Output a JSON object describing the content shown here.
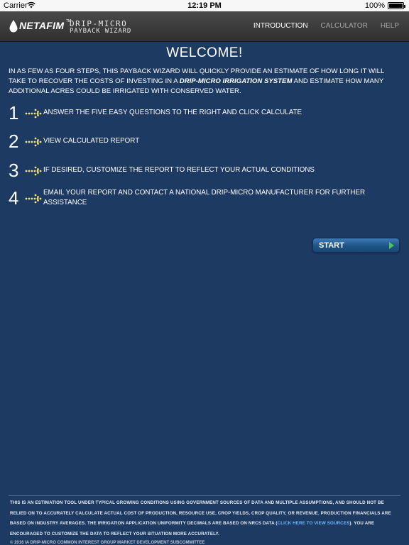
{
  "status_bar": {
    "carrier": "Carrier",
    "time": "12:19 PM",
    "battery": "100%",
    "battery_level": 1.0
  },
  "header": {
    "brand": "NETAFIM",
    "trademark": "TM",
    "product": "DRIP-MICRO",
    "subtitle": "PAYBACK WIZARD",
    "tabs": [
      {
        "label": "INTRODUCTION",
        "active": true
      },
      {
        "label": "CALCULATOR",
        "active": false
      },
      {
        "label": "HELP",
        "active": false
      }
    ]
  },
  "main": {
    "title": "WELCOME!",
    "intro_before": "IN AS FEW AS FOUR STEPS, THIS PAYBACK WIZARD WILL QUICKLY PROVIDE AN ESTIMATE OF HOW LONG IT WILL TAKE TO RECOVER THE COSTS OF INVESTING IN A ",
    "intro_emphasis": "DRIP-MICRO IRRIGATION SYSTEM",
    "intro_after": " AND ESTIMATE HOW MANY ADDITIONAL ACRES COULD BE IRRIGATED WITH CONSERVED WATER.",
    "steps": [
      {
        "number": "1",
        "text": "ANSWER THE FIVE EASY QUESTIONS TO THE RIGHT AND CLICK CALCULATE"
      },
      {
        "number": "2",
        "text": "VIEW CALCULATED REPORT"
      },
      {
        "number": "3",
        "text": "IF DESIRED, CUSTOMIZE THE REPORT TO REFLECT YOUR ACTUAL CONDITIONS"
      },
      {
        "number": "4",
        "text": "EMAIL YOUR REPORT AND CONTACT A NATIONAL DRIP-MICRO MANUFACTURER FOR FURTHER ASSISTANCE"
      }
    ],
    "start_button": "START"
  },
  "footer": {
    "disclaimer_before": "THIS IS AN ESTIMATION TOOL UNDER TYPICAL GROWING CONDITIONS USING GOVERNMENT SOURCES OF DATA AND MULTIPLE ASSUMPTIONS, AND SHOULD NOT BE RELIED ON TO ACCURATELY CALCULATE ACTUAL COST OF PRODUCTION, RESOURCE USE, CROP YIELDS, CROP QUALITY, OR REVENUE. PRODUCTION FINANCIALS ARE BASED ON INDUSTRY AVERAGES. THE IRRIGATION APPLICATION UNIFORMITY DECIMALS ARE BASED ON NRCS DATA (",
    "disclaimer_link": "CLICK HERE TO VIEW SOURCES",
    "disclaimer_after": "). YOU ARE ENCOURAGED TO CUSTOMIZE THE DATA TO REFLECT YOUR SITUATION MORE ACCURATELY.",
    "copyright": "© 2016 IA DRIP-MICRO COMMON INTEREST GROUP MARKET DEVELOPMENT SUBCOMMITTEE"
  },
  "colors": {
    "background": "#1d3a63",
    "header": "#3a3a3a",
    "arrow": "#f2e27a",
    "link": "#6db7ff",
    "play": "#4fc25a"
  }
}
